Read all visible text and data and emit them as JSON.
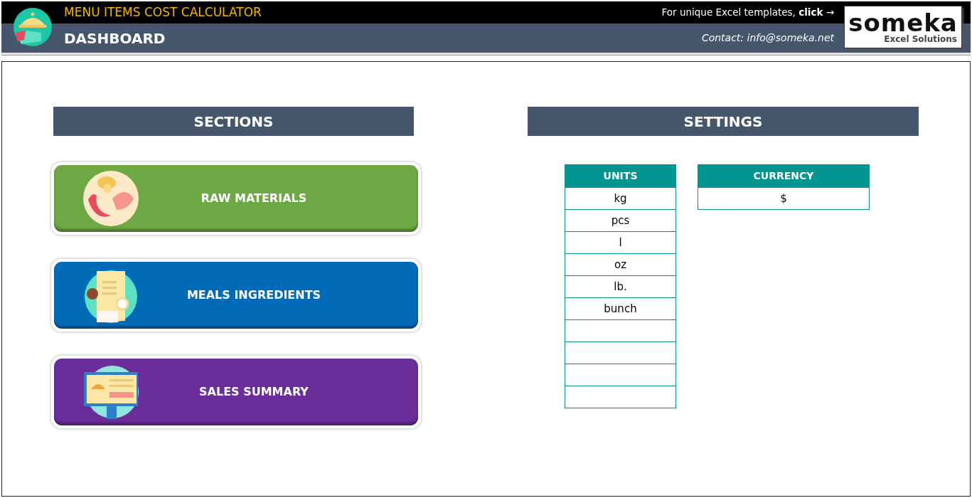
{
  "header": {
    "title": "MENU ITEMS COST CALCULATOR",
    "subtitle": "DASHBOARD",
    "promo": "For unique Excel templates, **click** →",
    "contact": "Contact: info@someka.net",
    "logo": {
      "name": "someka",
      "tagline": "Excel Solutions"
    }
  },
  "sections": {
    "title": "SECTIONS",
    "buttons": [
      {
        "label": "RAW MATERIALS",
        "kind": "food",
        "color": "#6ea844"
      },
      {
        "label": "MEALS INGREDIENTS",
        "kind": "menu",
        "color": "#016bb8"
      },
      {
        "label": "SALES SUMMARY",
        "kind": "screen",
        "color": "#6b2d9a"
      }
    ]
  },
  "settings": {
    "title": "SETTINGS",
    "tables": [
      {
        "heading": "UNITS",
        "rows": [
          {
            "text": "kg"
          },
          {
            "text": "pcs"
          },
          {
            "text": "l"
          },
          {
            "text": "oz"
          },
          {
            "text": "lb."
          },
          {
            "text": "bunch"
          },
          {},
          {},
          {},
          {}
        ]
      },
      {
        "heading": "CURRENCY",
        "rows": [
          {
            "text": "$"
          }
        ]
      }
    ]
  }
}
